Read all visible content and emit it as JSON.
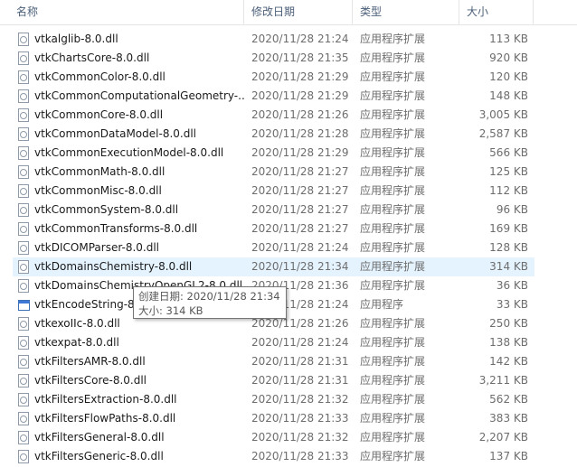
{
  "columns": {
    "name": "名称",
    "date": "修改日期",
    "type": "类型",
    "size": "大小",
    "sort_indicator": "^"
  },
  "rows": [
    {
      "name": "vtkalglib-8.0.dll",
      "date": "2020/11/28 21:24",
      "type": "应用程序扩展",
      "size": "113 KB",
      "icon": "dll-file-icon"
    },
    {
      "name": "vtkChartsCore-8.0.dll",
      "date": "2020/11/28 21:35",
      "type": "应用程序扩展",
      "size": "920 KB",
      "icon": "dll-file-icon"
    },
    {
      "name": "vtkCommonColor-8.0.dll",
      "date": "2020/11/28 21:29",
      "type": "应用程序扩展",
      "size": "120 KB",
      "icon": "dll-file-icon"
    },
    {
      "name": "vtkCommonComputationalGeometry-...",
      "date": "2020/11/28 21:29",
      "type": "应用程序扩展",
      "size": "148 KB",
      "icon": "dll-file-icon"
    },
    {
      "name": "vtkCommonCore-8.0.dll",
      "date": "2020/11/28 21:26",
      "type": "应用程序扩展",
      "size": "3,005 KB",
      "icon": "dll-file-icon"
    },
    {
      "name": "vtkCommonDataModel-8.0.dll",
      "date": "2020/11/28 21:28",
      "type": "应用程序扩展",
      "size": "2,587 KB",
      "icon": "dll-file-icon"
    },
    {
      "name": "vtkCommonExecutionModel-8.0.dll",
      "date": "2020/11/28 21:29",
      "type": "应用程序扩展",
      "size": "566 KB",
      "icon": "dll-file-icon"
    },
    {
      "name": "vtkCommonMath-8.0.dll",
      "date": "2020/11/28 21:27",
      "type": "应用程序扩展",
      "size": "125 KB",
      "icon": "dll-file-icon"
    },
    {
      "name": "vtkCommonMisc-8.0.dll",
      "date": "2020/11/28 21:27",
      "type": "应用程序扩展",
      "size": "112 KB",
      "icon": "dll-file-icon"
    },
    {
      "name": "vtkCommonSystem-8.0.dll",
      "date": "2020/11/28 21:27",
      "type": "应用程序扩展",
      "size": "96 KB",
      "icon": "dll-file-icon"
    },
    {
      "name": "vtkCommonTransforms-8.0.dll",
      "date": "2020/11/28 21:27",
      "type": "应用程序扩展",
      "size": "169 KB",
      "icon": "dll-file-icon"
    },
    {
      "name": "vtkDICOMParser-8.0.dll",
      "date": "2020/11/28 21:24",
      "type": "应用程序扩展",
      "size": "128 KB",
      "icon": "dll-file-icon"
    },
    {
      "name": "vtkDomainsChemistry-8.0.dll",
      "date": "2020/11/28 21:34",
      "type": "应用程序扩展",
      "size": "314 KB",
      "icon": "dll-file-icon",
      "hover": true
    },
    {
      "name": "vtkDomainsChemistryOpenGL2-8.0.dll",
      "date": "2020/11/28 21:36",
      "type": "应用程序扩展",
      "size": "36 KB",
      "icon": "dll-file-icon"
    },
    {
      "name": "vtkEncodeString-8.0.exe",
      "date": "2020/11/28 21:24",
      "type": "应用程序",
      "size": "33 KB",
      "icon": "exe-file-icon"
    },
    {
      "name": "vtkexoIIc-8.0.dll",
      "date": "2020/11/28 21:26",
      "type": "应用程序扩展",
      "size": "250 KB",
      "icon": "dll-file-icon"
    },
    {
      "name": "vtkexpat-8.0.dll",
      "date": "2020/11/28 21:24",
      "type": "应用程序扩展",
      "size": "138 KB",
      "icon": "dll-file-icon"
    },
    {
      "name": "vtkFiltersAMR-8.0.dll",
      "date": "2020/11/28 21:31",
      "type": "应用程序扩展",
      "size": "142 KB",
      "icon": "dll-file-icon"
    },
    {
      "name": "vtkFiltersCore-8.0.dll",
      "date": "2020/11/28 21:31",
      "type": "应用程序扩展",
      "size": "3,211 KB",
      "icon": "dll-file-icon"
    },
    {
      "name": "vtkFiltersExtraction-8.0.dll",
      "date": "2020/11/28 21:32",
      "type": "应用程序扩展",
      "size": "562 KB",
      "icon": "dll-file-icon"
    },
    {
      "name": "vtkFiltersFlowPaths-8.0.dll",
      "date": "2020/11/28 21:33",
      "type": "应用程序扩展",
      "size": "383 KB",
      "icon": "dll-file-icon"
    },
    {
      "name": "vtkFiltersGeneral-8.0.dll",
      "date": "2020/11/28 21:32",
      "type": "应用程序扩展",
      "size": "2,207 KB",
      "icon": "dll-file-icon"
    },
    {
      "name": "vtkFiltersGeneric-8.0.dll",
      "date": "2020/11/28 21:33",
      "type": "应用程序扩展",
      "size": "137 KB",
      "icon": "dll-file-icon"
    }
  ],
  "tooltip": {
    "created": "创建日期: 2020/11/28 21:34",
    "size": "大小: 314 KB"
  },
  "colors": {
    "hover_row": "#e5f3ff",
    "header_text": "#4c607a",
    "secondary_text": "#6d6d6d"
  }
}
